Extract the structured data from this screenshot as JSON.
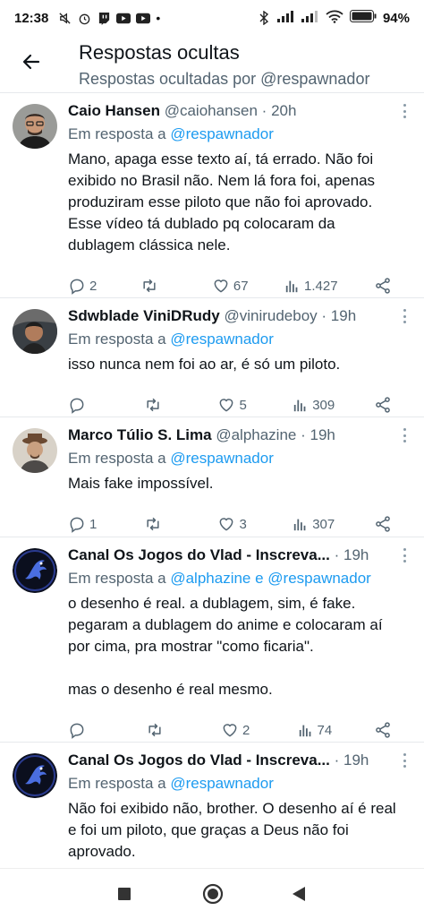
{
  "status_bar": {
    "time": "12:38",
    "battery": "94"
  },
  "header": {
    "title": "Respostas ocultas",
    "subtitle": "Respostas ocultadas por @respawnador"
  },
  "tweets": [
    {
      "name": "Caio Hansen",
      "handle": "@caiohansen",
      "dot": "·",
      "time": "20h",
      "reply_prefix": "Em resposta a",
      "reply_to": "@respawnador",
      "text": "Mano, apaga esse texto aí, tá errado. Não foi exibido no Brasil não. Nem lá fora foi, apenas produziram esse piloto que não foi aprovado. Esse vídeo tá dublado pq colocaram da dublagem clássica nele.",
      "replies": "2",
      "retweets": "",
      "likes": "67",
      "views": "1.427"
    },
    {
      "name": "Sdwblade ViniDRudy",
      "handle": "@vinirudeboy",
      "dot": "·",
      "time": "19h",
      "reply_prefix": "Em resposta a",
      "reply_to": "@respawnador",
      "text": "isso nunca nem foi ao ar, é só um piloto.",
      "replies": "",
      "retweets": "",
      "likes": "5",
      "views": "309"
    },
    {
      "name": "Marco Túlio S. Lima",
      "handle": "@alphazine",
      "dot": "·",
      "time": "19h",
      "reply_prefix": "Em resposta a",
      "reply_to": "@respawnador",
      "text": "Mais fake impossível.",
      "replies": "1",
      "retweets": "",
      "likes": "3",
      "views": "307"
    },
    {
      "name": "Canal Os Jogos do Vlad - Inscreva...",
      "handle": "",
      "dot": "·",
      "time": "19h",
      "reply_prefix": "Em resposta a",
      "reply_to": "@alphazine e @respawnador",
      "text": "o desenho é real. a dublagem, sim, é fake. pegaram a dublagem do anime e colocaram aí por cima, pra mostrar \"como ficaria\".\n\nmas o desenho é real mesmo.",
      "replies": "",
      "retweets": "",
      "likes": "2",
      "views": "74"
    },
    {
      "name": "Canal Os Jogos do Vlad - Inscreva...",
      "handle": "",
      "dot": "·",
      "time": "19h",
      "reply_prefix": "Em resposta a",
      "reply_to": "@respawnador",
      "text": "Não foi exibido não, brother. O desenho aí é real e foi um piloto, que graças a Deus não foi aprovado.",
      "replies": "",
      "retweets": "",
      "likes": "",
      "views": ""
    }
  ]
}
